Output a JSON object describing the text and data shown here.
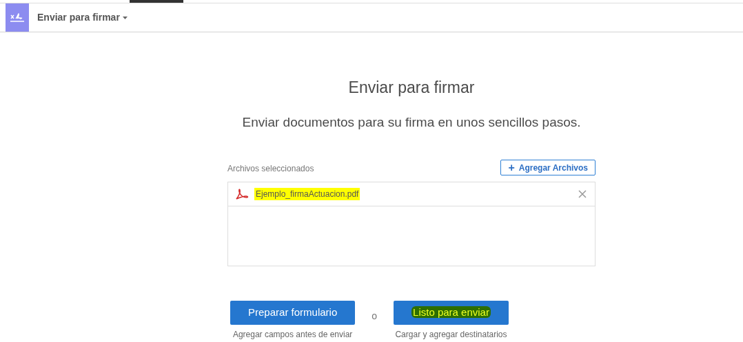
{
  "header": {
    "title": "Enviar para firmar"
  },
  "main": {
    "title": "Enviar para firmar",
    "subtitle": "Enviar documentos para su firma en unos sencillos pasos.",
    "files_label": "Archivos seleccionados",
    "add_button": {
      "icon": "+",
      "label": "Agregar Archivos"
    },
    "files": [
      {
        "name": "Ejemplo_firmaActuacion.pdf",
        "highlighted": true
      }
    ]
  },
  "actions": [
    {
      "label": "Preparar formulario",
      "caption": "Agregar campos antes de enviar",
      "highlighted": false
    },
    {
      "label": "Listo para enviar",
      "caption": "Cargar y agregar destinatarios",
      "highlighted": true
    }
  ],
  "separator": "o"
}
